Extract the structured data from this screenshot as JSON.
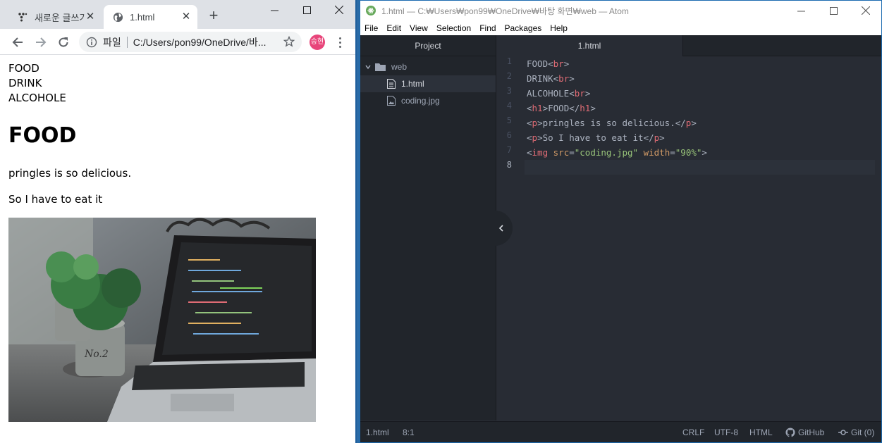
{
  "chrome": {
    "tabs": [
      {
        "title": "새로운 글쓰기",
        "active": false
      },
      {
        "title": "1.html",
        "active": true
      }
    ],
    "address": {
      "scheme_label": "파일",
      "url": "C:/Users/pon99/OneDrive/바..."
    },
    "profile_initial": "승현",
    "page": {
      "lines": [
        "FOOD",
        "DRINK",
        "ALCOHOLE"
      ],
      "heading": "FOOD",
      "paragraphs": [
        "pringles is so delicious.",
        "So I have to eat it"
      ],
      "image_alt": "coding.jpg"
    }
  },
  "atom": {
    "title": "1.html — C:₩Users₩pon99₩OneDrive₩바탕 화면₩web — Atom",
    "menu": [
      "File",
      "Edit",
      "View",
      "Selection",
      "Find",
      "Packages",
      "Help"
    ],
    "tree": {
      "header": "Project",
      "folder": "web",
      "files": [
        "1.html",
        "coding.jpg"
      ],
      "selected": "1.html"
    },
    "editor_tab": "1.html",
    "line_numbers": [
      "1",
      "2",
      "3",
      "4",
      "5",
      "6",
      "7",
      "8"
    ],
    "code": [
      [
        {
          "t": "FOOD",
          "c": "punc"
        },
        {
          "t": "<",
          "c": "punc"
        },
        {
          "t": "br",
          "c": "tag"
        },
        {
          "t": ">",
          "c": "punc"
        }
      ],
      [
        {
          "t": "DRINK",
          "c": "punc"
        },
        {
          "t": "<",
          "c": "punc"
        },
        {
          "t": "br",
          "c": "tag"
        },
        {
          "t": ">",
          "c": "punc"
        }
      ],
      [
        {
          "t": "ALCOHOLE",
          "c": "punc"
        },
        {
          "t": "<",
          "c": "punc"
        },
        {
          "t": "br",
          "c": "tag"
        },
        {
          "t": ">",
          "c": "punc"
        }
      ],
      [
        {
          "t": "<",
          "c": "punc"
        },
        {
          "t": "h1",
          "c": "tag"
        },
        {
          "t": ">FOOD</",
          "c": "punc"
        },
        {
          "t": "h1",
          "c": "tag"
        },
        {
          "t": ">",
          "c": "punc"
        }
      ],
      [
        {
          "t": "<",
          "c": "punc"
        },
        {
          "t": "p",
          "c": "tag"
        },
        {
          "t": ">pringles is so delicious.</",
          "c": "punc"
        },
        {
          "t": "p",
          "c": "tag"
        },
        {
          "t": ">",
          "c": "punc"
        }
      ],
      [
        {
          "t": "<",
          "c": "punc"
        },
        {
          "t": "p",
          "c": "tag"
        },
        {
          "t": ">So I have to eat it</",
          "c": "punc"
        },
        {
          "t": "p",
          "c": "tag"
        },
        {
          "t": ">",
          "c": "punc"
        }
      ],
      [
        {
          "t": "<",
          "c": "punc"
        },
        {
          "t": "img",
          "c": "tag"
        },
        {
          "t": " ",
          "c": "punc"
        },
        {
          "t": "src",
          "c": "attr"
        },
        {
          "t": "=",
          "c": "punc"
        },
        {
          "t": "\"coding.jpg\"",
          "c": "str"
        },
        {
          "t": " ",
          "c": "punc"
        },
        {
          "t": "width",
          "c": "attr"
        },
        {
          "t": "=",
          "c": "punc"
        },
        {
          "t": "\"90%\"",
          "c": "str"
        },
        {
          "t": ">",
          "c": "punc"
        }
      ],
      []
    ],
    "status": {
      "file": "1.html",
      "cursor": "8:1",
      "line_ending": "CRLF",
      "encoding": "UTF-8",
      "grammar": "HTML",
      "github": "GitHub",
      "git": "Git (0)"
    }
  },
  "colors": {
    "atom_bg": "#282c34",
    "tag": "#e06c75",
    "attr": "#d19a66",
    "string": "#98c379",
    "avatar": "#e8457a"
  }
}
